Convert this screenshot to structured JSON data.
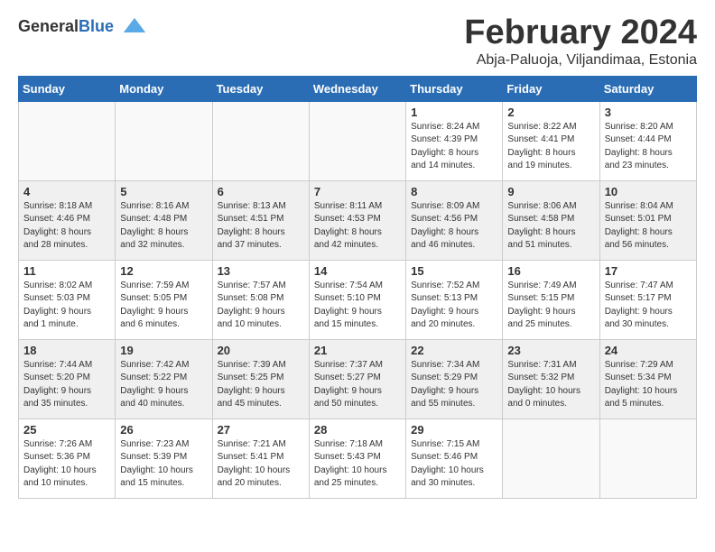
{
  "header": {
    "logo_general": "General",
    "logo_blue": "Blue",
    "title": "February 2024",
    "subtitle": "Abja-Paluoja, Viljandimaa, Estonia"
  },
  "days_of_week": [
    "Sunday",
    "Monday",
    "Tuesday",
    "Wednesday",
    "Thursday",
    "Friday",
    "Saturday"
  ],
  "weeks": [
    [
      {
        "day": "",
        "info": "",
        "empty": true
      },
      {
        "day": "",
        "info": "",
        "empty": true
      },
      {
        "day": "",
        "info": "",
        "empty": true
      },
      {
        "day": "",
        "info": "",
        "empty": true
      },
      {
        "day": "1",
        "info": "Sunrise: 8:24 AM\nSunset: 4:39 PM\nDaylight: 8 hours\nand 14 minutes."
      },
      {
        "day": "2",
        "info": "Sunrise: 8:22 AM\nSunset: 4:41 PM\nDaylight: 8 hours\nand 19 minutes."
      },
      {
        "day": "3",
        "info": "Sunrise: 8:20 AM\nSunset: 4:44 PM\nDaylight: 8 hours\nand 23 minutes."
      }
    ],
    [
      {
        "day": "4",
        "info": "Sunrise: 8:18 AM\nSunset: 4:46 PM\nDaylight: 8 hours\nand 28 minutes."
      },
      {
        "day": "5",
        "info": "Sunrise: 8:16 AM\nSunset: 4:48 PM\nDaylight: 8 hours\nand 32 minutes."
      },
      {
        "day": "6",
        "info": "Sunrise: 8:13 AM\nSunset: 4:51 PM\nDaylight: 8 hours\nand 37 minutes."
      },
      {
        "day": "7",
        "info": "Sunrise: 8:11 AM\nSunset: 4:53 PM\nDaylight: 8 hours\nand 42 minutes."
      },
      {
        "day": "8",
        "info": "Sunrise: 8:09 AM\nSunset: 4:56 PM\nDaylight: 8 hours\nand 46 minutes."
      },
      {
        "day": "9",
        "info": "Sunrise: 8:06 AM\nSunset: 4:58 PM\nDaylight: 8 hours\nand 51 minutes."
      },
      {
        "day": "10",
        "info": "Sunrise: 8:04 AM\nSunset: 5:01 PM\nDaylight: 8 hours\nand 56 minutes."
      }
    ],
    [
      {
        "day": "11",
        "info": "Sunrise: 8:02 AM\nSunset: 5:03 PM\nDaylight: 9 hours\nand 1 minute."
      },
      {
        "day": "12",
        "info": "Sunrise: 7:59 AM\nSunset: 5:05 PM\nDaylight: 9 hours\nand 6 minutes."
      },
      {
        "day": "13",
        "info": "Sunrise: 7:57 AM\nSunset: 5:08 PM\nDaylight: 9 hours\nand 10 minutes."
      },
      {
        "day": "14",
        "info": "Sunrise: 7:54 AM\nSunset: 5:10 PM\nDaylight: 9 hours\nand 15 minutes."
      },
      {
        "day": "15",
        "info": "Sunrise: 7:52 AM\nSunset: 5:13 PM\nDaylight: 9 hours\nand 20 minutes."
      },
      {
        "day": "16",
        "info": "Sunrise: 7:49 AM\nSunset: 5:15 PM\nDaylight: 9 hours\nand 25 minutes."
      },
      {
        "day": "17",
        "info": "Sunrise: 7:47 AM\nSunset: 5:17 PM\nDaylight: 9 hours\nand 30 minutes."
      }
    ],
    [
      {
        "day": "18",
        "info": "Sunrise: 7:44 AM\nSunset: 5:20 PM\nDaylight: 9 hours\nand 35 minutes."
      },
      {
        "day": "19",
        "info": "Sunrise: 7:42 AM\nSunset: 5:22 PM\nDaylight: 9 hours\nand 40 minutes."
      },
      {
        "day": "20",
        "info": "Sunrise: 7:39 AM\nSunset: 5:25 PM\nDaylight: 9 hours\nand 45 minutes."
      },
      {
        "day": "21",
        "info": "Sunrise: 7:37 AM\nSunset: 5:27 PM\nDaylight: 9 hours\nand 50 minutes."
      },
      {
        "day": "22",
        "info": "Sunrise: 7:34 AM\nSunset: 5:29 PM\nDaylight: 9 hours\nand 55 minutes."
      },
      {
        "day": "23",
        "info": "Sunrise: 7:31 AM\nSunset: 5:32 PM\nDaylight: 10 hours\nand 0 minutes."
      },
      {
        "day": "24",
        "info": "Sunrise: 7:29 AM\nSunset: 5:34 PM\nDaylight: 10 hours\nand 5 minutes."
      }
    ],
    [
      {
        "day": "25",
        "info": "Sunrise: 7:26 AM\nSunset: 5:36 PM\nDaylight: 10 hours\nand 10 minutes."
      },
      {
        "day": "26",
        "info": "Sunrise: 7:23 AM\nSunset: 5:39 PM\nDaylight: 10 hours\nand 15 minutes."
      },
      {
        "day": "27",
        "info": "Sunrise: 7:21 AM\nSunset: 5:41 PM\nDaylight: 10 hours\nand 20 minutes."
      },
      {
        "day": "28",
        "info": "Sunrise: 7:18 AM\nSunset: 5:43 PM\nDaylight: 10 hours\nand 25 minutes."
      },
      {
        "day": "29",
        "info": "Sunrise: 7:15 AM\nSunset: 5:46 PM\nDaylight: 10 hours\nand 30 minutes."
      },
      {
        "day": "",
        "info": "",
        "empty": true
      },
      {
        "day": "",
        "info": "",
        "empty": true
      }
    ]
  ]
}
